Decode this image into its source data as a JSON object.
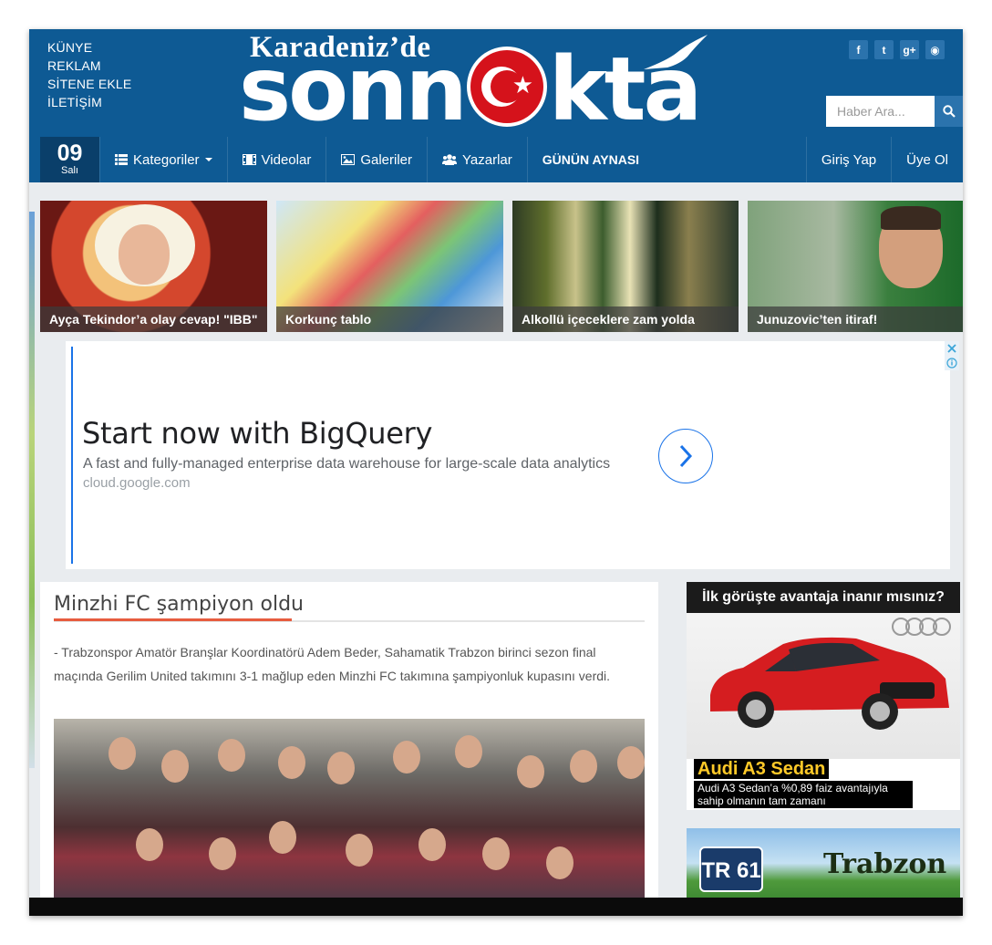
{
  "header": {
    "top_links": [
      "KÜNYE",
      "REKLAM",
      "SİTENE EKLE",
      "İLETİŞİM"
    ],
    "logo_small": "Karadeniz’de",
    "logo_big_left": "sonn",
    "logo_big_right": "kta",
    "social": [
      {
        "icon": "facebook-icon",
        "glyph": "f"
      },
      {
        "icon": "twitter-icon",
        "glyph": "t"
      },
      {
        "icon": "google-plus-icon",
        "glyph": "g+"
      },
      {
        "icon": "rss-icon",
        "glyph": "◉"
      }
    ],
    "search_placeholder": "Haber Ara...",
    "brand_color": "#0e5a94"
  },
  "nav": {
    "date_day": "09",
    "date_weekday": "Salı",
    "items": [
      {
        "label": "Kategoriler",
        "icon": "list-icon"
      },
      {
        "label": "Videolar",
        "icon": "film-icon"
      },
      {
        "label": "Galeriler",
        "icon": "image-icon"
      },
      {
        "label": "Yazarlar",
        "icon": "users-icon"
      },
      {
        "label": "GÜNÜN AYNASI",
        "icon": ""
      }
    ],
    "right": [
      "Giriş Yap",
      "Üye Ol"
    ]
  },
  "gallery": [
    {
      "caption": "Ayça Tekindor’a olay cevap! \"IBB\""
    },
    {
      "caption": "Korkunç tablo"
    },
    {
      "caption": "Alkollü içeceklere zam yolda"
    },
    {
      "caption": "Junuzovic’ten itiraf!"
    }
  ],
  "ad": {
    "title": "Start now with BigQuery",
    "description": "A fast and fully-managed enterprise data warehouse for large-scale data analytics",
    "url": "cloud.google.com"
  },
  "article": {
    "title": "Minzhi FC şampiyon oldu",
    "body": "- Trabzonspor Amatör Branşlar Koordinatörü Adem Beder, Sahamatik Trabzon birinci sezon final maçında Gerilim United takımını 3-1 mağlup eden Minzhi FC takımına şampiyonluk kupasını verdi."
  },
  "sidebar_ads": {
    "audi_header": "İlk görüşte avantaja inanır mısınız?",
    "audi_model": "Audi A3 Sedan",
    "audi_text": "Audi A3 Sedan’a %0,89 faiz avantajıyla sahip olmanın tam zamanı",
    "tr61_logo": "TR 61",
    "tr61_text": "Trabzon"
  }
}
